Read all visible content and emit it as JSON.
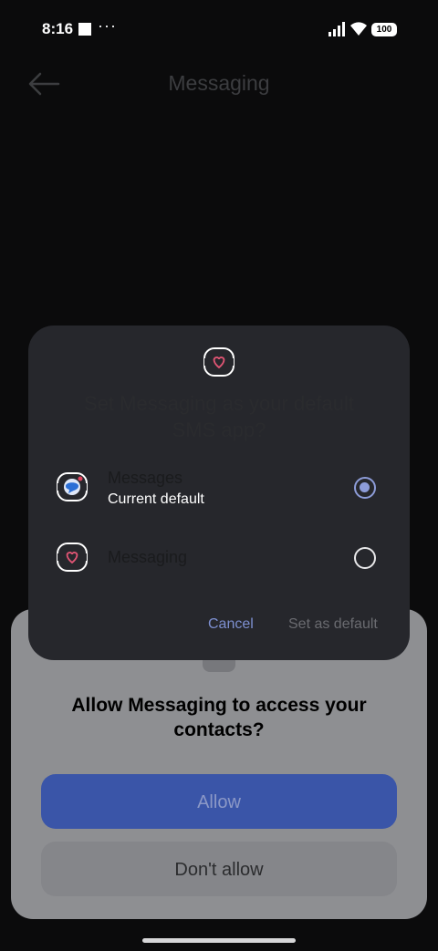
{
  "status_bar": {
    "time": "8:16",
    "overflow": "···",
    "battery_level": "100",
    "icons": [
      "square-notification-icon",
      "signal-icon",
      "wifi-icon",
      "battery-icon"
    ]
  },
  "app_bar": {
    "title": "Messaging",
    "back_icon": "arrow-left-icon"
  },
  "background_prompt": {
    "text": "Set Messaging as your default SMS app?"
  },
  "default_sms_dialog": {
    "icon": "messaging-chat-heart-icon",
    "options": [
      {
        "name": "Messages",
        "subtitle": "Current default",
        "selected": true,
        "icon": "messages-app-icon"
      },
      {
        "name": "Messaging",
        "subtitle": "",
        "selected": false,
        "icon": "messaging-app-icon"
      }
    ],
    "cancel_label": "Cancel",
    "set_default_label": "Set as default"
  },
  "permission_sheet": {
    "icon": "contacts-icon",
    "title": "Allow Messaging to access your contacts?",
    "allow_label": "Allow",
    "deny_label": "Don't allow"
  },
  "colors": {
    "accent": "#8d9cd8",
    "dialog_bg": "#26272c",
    "allow_button": "#3a55a8"
  }
}
